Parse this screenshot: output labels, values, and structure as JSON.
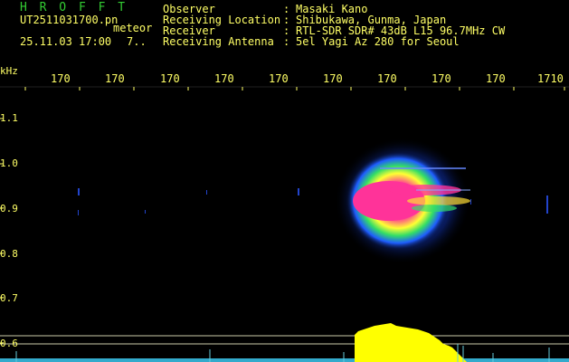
{
  "header": {
    "brand": "H R O F F T",
    "filename": "UT2511031700.pn",
    "type_label": "meteor",
    "datetime": "25.11.03 17:00",
    "index": "7..",
    "fields": [
      {
        "label": "Observer",
        "sep": ":",
        "value": "Masaki Kano"
      },
      {
        "label": "Receiving Location",
        "sep": ":",
        "value": "Shibukawa, Gunma, Japan"
      },
      {
        "label": "Receiver",
        "sep": ":",
        "value": "RTL-SDR SDR# 43dB L15 96.7MHz CW"
      },
      {
        "label": "Receiving Antenna",
        "sep": ":",
        "value": "5el Yagi Az 280 for Seoul"
      }
    ]
  },
  "axes": {
    "y_unit": "kHz",
    "x_ticks": [
      "170",
      "170",
      "170",
      "170",
      "170",
      "170",
      "170",
      "170",
      "170",
      "1710"
    ],
    "y_ticks": [
      "1.1",
      "1.0",
      "0.9",
      "0.8",
      "0.7",
      "0.6"
    ]
  },
  "colors": {
    "header_text": "#ffff66",
    "brand": "#33cc33",
    "signal_core": "#ff3399",
    "signal_mid": "#33cc66",
    "signal_outer": "#3366ff",
    "amplitude": "#ffff00"
  }
}
